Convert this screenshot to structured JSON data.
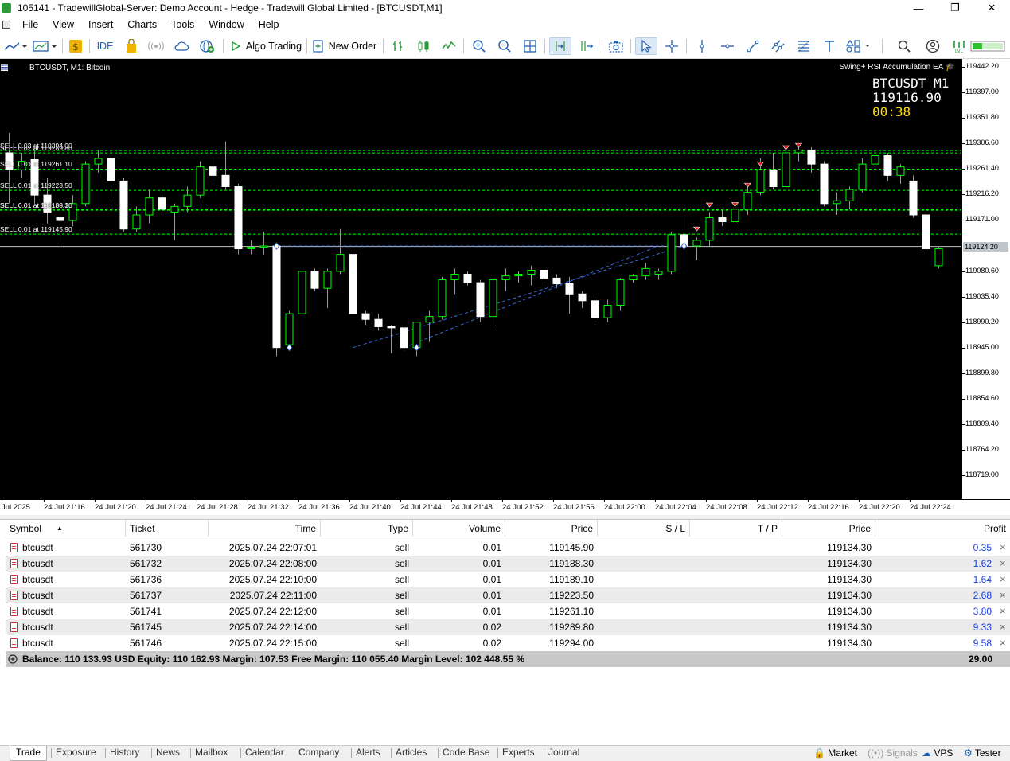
{
  "window": {
    "title": "105141 - TradewillGlobal-Server: Demo Account - Hedge - Tradewill Global Limited - [BTCUSDT,M1]",
    "minimize": "—",
    "restore": "❐",
    "close": "✕"
  },
  "menu": [
    "File",
    "View",
    "Insert",
    "Charts",
    "Tools",
    "Window",
    "Help"
  ],
  "toolbar": {
    "ide": "IDE",
    "algo_trading": "Algo Trading",
    "new_order": "New Order"
  },
  "chart": {
    "title": "BTCUSDT, M1: Bitcoin",
    "ea_name": "Swing+ RSI Accumulation EA",
    "symbol_timeframe": "BTCUSDT M1",
    "last_price": "119116.90",
    "countdown": "00:38",
    "current_price_label": "119124.20",
    "price_labels": [
      "119442.20",
      "119397.00",
      "119351.80",
      "119306.60",
      "119261.40",
      "119216.20",
      "119171.00",
      "119124.20",
      "119080.60",
      "119035.40",
      "118990.20",
      "118945.00",
      "118899.80",
      "118854.60",
      "118809.40",
      "118764.20",
      "118719.00"
    ],
    "time_labels": [
      "Jul 2025",
      "24 Jul 21:16",
      "24 Jul 21:20",
      "24 Jul 21:24",
      "24 Jul 21:28",
      "24 Jul 21:32",
      "24 Jul 21:36",
      "24 Jul 21:40",
      "24 Jul 21:44",
      "24 Jul 21:48",
      "24 Jul 21:52",
      "24 Jul 21:56",
      "24 Jul 22:00",
      "24 Jul 22:04",
      "24 Jul 22:08",
      "24 Jul 22:12",
      "24 Jul 22:16",
      "24 Jul 22:20",
      "24 Jul 22:24"
    ],
    "order_labels": [
      {
        "text": "SELL 0.02 at 119294.00",
        "price": 119294.0
      },
      {
        "text": "SELL 0.02 at 119289.80",
        "price": 119289.8
      },
      {
        "text": "SELL 0.01 at 119261.10",
        "price": 119261.1
      },
      {
        "text": "SELL 0.01 at 119223.50",
        "price": 119223.5
      },
      {
        "text": "SELL 0.01 at 119189.10",
        "price": 119189.1
      },
      {
        "text": "SELL 0.01 at 119188.30",
        "price": 119188.3
      },
      {
        "text": "SELL 0.01 at 119145.90",
        "price": 119145.9
      }
    ],
    "bid_price": 119124.2,
    "bull_color": "#ffffff",
    "bear_color": "#ffffff",
    "wick_color": "#00ff00",
    "level_color": "#00ff00"
  },
  "chart_data": {
    "type": "candlestick",
    "title": "BTCUSDT, M1: Bitcoin",
    "y_unit": "price",
    "ylim": [
      118700,
      119460
    ],
    "grid": false,
    "candles": [
      {
        "t": "21:13",
        "o": 119290,
        "h": 119325,
        "l": 119200,
        "c": 119260
      },
      {
        "t": "21:14",
        "o": 119260,
        "h": 119290,
        "l": 119245,
        "c": 119275
      },
      {
        "t": "21:15",
        "o": 119278,
        "h": 119305,
        "l": 119200,
        "c": 119215
      },
      {
        "t": "21:16",
        "o": 119215,
        "h": 119245,
        "l": 119165,
        "c": 119185
      },
      {
        "t": "21:17",
        "o": 119175,
        "h": 119205,
        "l": 119125,
        "c": 119170
      },
      {
        "t": "21:18",
        "o": 119170,
        "h": 119215,
        "l": 119160,
        "c": 119200
      },
      {
        "t": "21:19",
        "o": 119200,
        "h": 119275,
        "l": 119195,
        "c": 119270
      },
      {
        "t": "21:20",
        "o": 119270,
        "h": 119295,
        "l": 119255,
        "c": 119280
      },
      {
        "t": "21:21",
        "o": 119280,
        "h": 119285,
        "l": 119205,
        "c": 119240
      },
      {
        "t": "21:22",
        "o": 119240,
        "h": 119245,
        "l": 119150,
        "c": 119155
      },
      {
        "t": "21:23",
        "o": 119155,
        "h": 119195,
        "l": 119150,
        "c": 119180
      },
      {
        "t": "21:24",
        "o": 119180,
        "h": 119225,
        "l": 119165,
        "c": 119210
      },
      {
        "t": "21:25",
        "o": 119210,
        "h": 119215,
        "l": 119180,
        "c": 119190
      },
      {
        "t": "21:26",
        "o": 119185,
        "h": 119200,
        "l": 119135,
        "c": 119195
      },
      {
        "t": "21:27",
        "o": 119195,
        "h": 119230,
        "l": 119185,
        "c": 119215
      },
      {
        "t": "21:28",
        "o": 119215,
        "h": 119275,
        "l": 119210,
        "c": 119265
      },
      {
        "t": "21:29",
        "o": 119265,
        "h": 119300,
        "l": 119240,
        "c": 119250
      },
      {
        "t": "21:30",
        "o": 119250,
        "h": 119310,
        "l": 119225,
        "c": 119230
      },
      {
        "t": "21:31",
        "o": 119230,
        "h": 119235,
        "l": 119110,
        "c": 119120
      },
      {
        "t": "21:32",
        "o": 119120,
        "h": 119135,
        "l": 119110,
        "c": 119123
      },
      {
        "t": "21:33",
        "o": 119123,
        "h": 119150,
        "l": 119110,
        "c": 119125
      },
      {
        "t": "21:34",
        "o": 119125,
        "h": 119130,
        "l": 118930,
        "c": 118945
      },
      {
        "t": "21:35",
        "o": 118950,
        "h": 119010,
        "l": 118945,
        "c": 119005
      },
      {
        "t": "21:36",
        "o": 119005,
        "h": 119085,
        "l": 119000,
        "c": 119080
      },
      {
        "t": "21:37",
        "o": 119080,
        "h": 119085,
        "l": 119045,
        "c": 119050
      },
      {
        "t": "21:38",
        "o": 119050,
        "h": 119085,
        "l": 119015,
        "c": 119080
      },
      {
        "t": "21:39",
        "o": 119080,
        "h": 119155,
        "l": 119075,
        "c": 119110
      },
      {
        "t": "21:40",
        "o": 119110,
        "h": 119115,
        "l": 119005,
        "c": 119005
      },
      {
        "t": "21:41",
        "o": 119005,
        "h": 119010,
        "l": 118985,
        "c": 118995
      },
      {
        "t": "21:42",
        "o": 118995,
        "h": 119005,
        "l": 118975,
        "c": 118982
      },
      {
        "t": "21:43",
        "o": 118982,
        "h": 118985,
        "l": 118935,
        "c": 118980
      },
      {
        "t": "21:44",
        "o": 118980,
        "h": 118985,
        "l": 118940,
        "c": 118945
      },
      {
        "t": "21:45",
        "o": 118945,
        "h": 118990,
        "l": 118930,
        "c": 118990
      },
      {
        "t": "21:46",
        "o": 118990,
        "h": 119010,
        "l": 118955,
        "c": 119000
      },
      {
        "t": "21:47",
        "o": 119000,
        "h": 119070,
        "l": 118995,
        "c": 119065
      },
      {
        "t": "21:48",
        "o": 119065,
        "h": 119085,
        "l": 119040,
        "c": 119075
      },
      {
        "t": "21:49",
        "o": 119075,
        "h": 119080,
        "l": 119055,
        "c": 119060
      },
      {
        "t": "21:50",
        "o": 119060,
        "h": 119065,
        "l": 118990,
        "c": 119000
      },
      {
        "t": "21:51",
        "o": 119000,
        "h": 119070,
        "l": 118980,
        "c": 119065
      },
      {
        "t": "21:52",
        "o": 119065,
        "h": 119085,
        "l": 119045,
        "c": 119072
      },
      {
        "t": "21:53",
        "o": 119072,
        "h": 119080,
        "l": 119060,
        "c": 119075
      },
      {
        "t": "21:54",
        "o": 119075,
        "h": 119090,
        "l": 119055,
        "c": 119082
      },
      {
        "t": "21:55",
        "o": 119082,
        "h": 119085,
        "l": 119060,
        "c": 119068
      },
      {
        "t": "21:56",
        "o": 119068,
        "h": 119075,
        "l": 119050,
        "c": 119058
      },
      {
        "t": "21:57",
        "o": 119058,
        "h": 119070,
        "l": 119005,
        "c": 119040
      },
      {
        "t": "21:58",
        "o": 119040,
        "h": 119045,
        "l": 119015,
        "c": 119028
      },
      {
        "t": "21:59",
        "o": 119028,
        "h": 119035,
        "l": 118990,
        "c": 118998
      },
      {
        "t": "22:00",
        "o": 118998,
        "h": 119030,
        "l": 118990,
        "c": 119020
      },
      {
        "t": "22:01",
        "o": 119020,
        "h": 119068,
        "l": 119010,
        "c": 119065
      },
      {
        "t": "22:02",
        "o": 119065,
        "h": 119075,
        "l": 119060,
        "c": 119072
      },
      {
        "t": "22:03",
        "o": 119072,
        "h": 119095,
        "l": 119065,
        "c": 119085
      },
      {
        "t": "22:04",
        "o": 119075,
        "h": 119085,
        "l": 119065,
        "c": 119080
      },
      {
        "t": "22:05",
        "o": 119080,
        "h": 119150,
        "l": 119075,
        "c": 119145
      },
      {
        "t": "22:06",
        "o": 119145,
        "h": 119180,
        "l": 119120,
        "c": 119125
      },
      {
        "t": "22:07",
        "o": 119125,
        "h": 119140,
        "l": 119100,
        "c": 119135
      },
      {
        "t": "22:08",
        "o": 119135,
        "h": 119185,
        "l": 119125,
        "c": 119175
      },
      {
        "t": "22:09",
        "o": 119175,
        "h": 119190,
        "l": 119160,
        "c": 119168
      },
      {
        "t": "22:10",
        "o": 119168,
        "h": 119200,
        "l": 119160,
        "c": 119190
      },
      {
        "t": "22:11",
        "o": 119190,
        "h": 119230,
        "l": 119180,
        "c": 119220
      },
      {
        "t": "22:12",
        "o": 119220,
        "h": 119280,
        "l": 119215,
        "c": 119260
      },
      {
        "t": "22:13",
        "o": 119260,
        "h": 119290,
        "l": 119225,
        "c": 119230
      },
      {
        "t": "22:14",
        "o": 119230,
        "h": 119295,
        "l": 119225,
        "c": 119290
      },
      {
        "t": "22:15",
        "o": 119290,
        "h": 119300,
        "l": 119275,
        "c": 119295
      },
      {
        "t": "22:16",
        "o": 119295,
        "h": 119300,
        "l": 119255,
        "c": 119270
      },
      {
        "t": "22:17",
        "o": 119270,
        "h": 119275,
        "l": 119195,
        "c": 119200
      },
      {
        "t": "22:18",
        "o": 119200,
        "h": 119220,
        "l": 119180,
        "c": 119205
      },
      {
        "t": "22:19",
        "o": 119205,
        "h": 119230,
        "l": 119190,
        "c": 119225
      },
      {
        "t": "22:20",
        "o": 119225,
        "h": 119280,
        "l": 119220,
        "c": 119270
      },
      {
        "t": "22:21",
        "o": 119270,
        "h": 119290,
        "l": 119265,
        "c": 119285
      },
      {
        "t": "22:22",
        "o": 119285,
        "h": 119290,
        "l": 119240,
        "c": 119250
      },
      {
        "t": "22:23",
        "o": 119250,
        "h": 119270,
        "l": 119235,
        "c": 119265
      },
      {
        "t": "22:24",
        "o": 119240,
        "h": 119250,
        "l": 119175,
        "c": 119180
      },
      {
        "t": "22:25",
        "o": 119180,
        "h": 119180,
        "l": 119115,
        "c": 119120
      },
      {
        "t": "22:26",
        "o": 119090,
        "h": 119125,
        "l": 119085,
        "c": 119120
      }
    ]
  },
  "trades": {
    "columns": [
      "Symbol",
      "Ticket",
      "Time",
      "Type",
      "Volume",
      "Price",
      "S / L",
      "T / P",
      "Price",
      "Profit"
    ],
    "rows": [
      {
        "symbol": "btcusdt",
        "ticket": "561730",
        "time": "2025.07.24 22:07:01",
        "type": "sell",
        "volume": "0.01",
        "price": "119145.90",
        "sl": "",
        "tp": "",
        "cur": "119134.30",
        "profit": "0.35"
      },
      {
        "symbol": "btcusdt",
        "ticket": "561732",
        "time": "2025.07.24 22:08:00",
        "type": "sell",
        "volume": "0.01",
        "price": "119188.30",
        "sl": "",
        "tp": "",
        "cur": "119134.30",
        "profit": "1.62"
      },
      {
        "symbol": "btcusdt",
        "ticket": "561736",
        "time": "2025.07.24 22:10:00",
        "type": "sell",
        "volume": "0.01",
        "price": "119189.10",
        "sl": "",
        "tp": "",
        "cur": "119134.30",
        "profit": "1.64"
      },
      {
        "symbol": "btcusdt",
        "ticket": "561737",
        "time": "2025.07.24 22:11:00",
        "type": "sell",
        "volume": "0.01",
        "price": "119223.50",
        "sl": "",
        "tp": "",
        "cur": "119134.30",
        "profit": "2.68"
      },
      {
        "symbol": "btcusdt",
        "ticket": "561741",
        "time": "2025.07.24 22:12:00",
        "type": "sell",
        "volume": "0.01",
        "price": "119261.10",
        "sl": "",
        "tp": "",
        "cur": "119134.30",
        "profit": "3.80"
      },
      {
        "symbol": "btcusdt",
        "ticket": "561745",
        "time": "2025.07.24 22:14:00",
        "type": "sell",
        "volume": "0.02",
        "price": "119289.80",
        "sl": "",
        "tp": "",
        "cur": "119134.30",
        "profit": "9.33"
      },
      {
        "symbol": "btcusdt",
        "ticket": "561746",
        "time": "2025.07.24 22:15:00",
        "type": "sell",
        "volume": "0.02",
        "price": "119294.00",
        "sl": "",
        "tp": "",
        "cur": "119134.30",
        "profit": "9.58"
      }
    ],
    "balance_line": "Balance: 110 133.93 USD  Equity: 110 162.93  Margin: 107.53  Free Margin: 110 055.40  Margin Level: 102 448.55 %",
    "total_profit": "29.00",
    "close_glyph": "×"
  },
  "bottom_tabs": [
    "Trade",
    "Exposure",
    "History",
    "News",
    "Mailbox",
    "Calendar",
    "Company",
    "Alerts",
    "Articles",
    "Code Base",
    "Experts",
    "Journal"
  ],
  "status": {
    "market": "Market",
    "signals": "Signals",
    "vps": "VPS",
    "tester": "Tester"
  }
}
